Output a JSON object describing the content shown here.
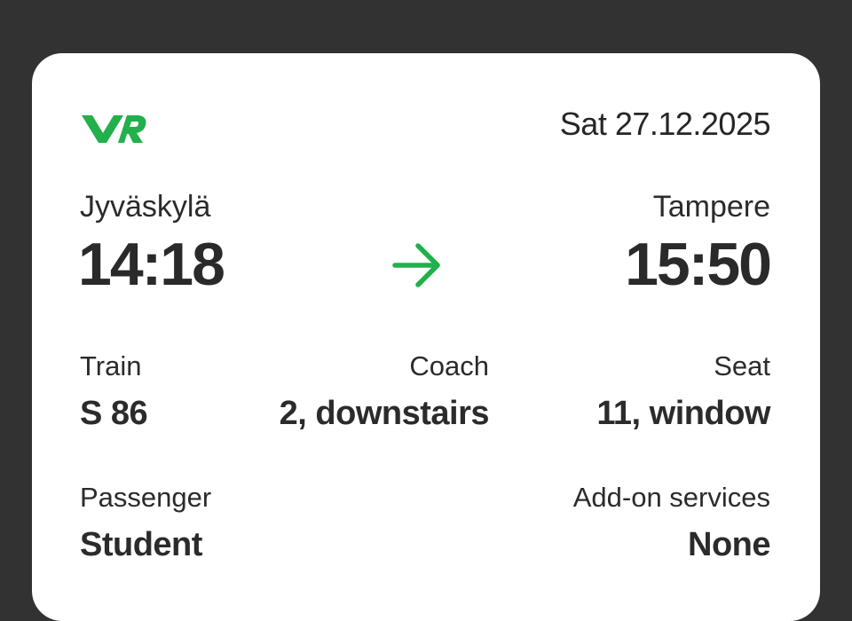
{
  "brand": {
    "logo_text": "VR",
    "accent_color": "#21b04b"
  },
  "ticket": {
    "date": "Sat 27.12.2025",
    "departure": {
      "station": "Jyväskylä",
      "time": "14:18"
    },
    "arrival": {
      "station": "Tampere",
      "time": "15:50"
    },
    "route_icon": "arrow-right-icon",
    "train": {
      "label": "Train",
      "value": "S 86"
    },
    "coach": {
      "label": "Coach",
      "value": "2, downstairs"
    },
    "seat": {
      "label": "Seat",
      "value": "11, window"
    },
    "passenger": {
      "label": "Passenger",
      "value": "Student"
    },
    "addons": {
      "label": "Add-on services",
      "value": "None"
    }
  }
}
